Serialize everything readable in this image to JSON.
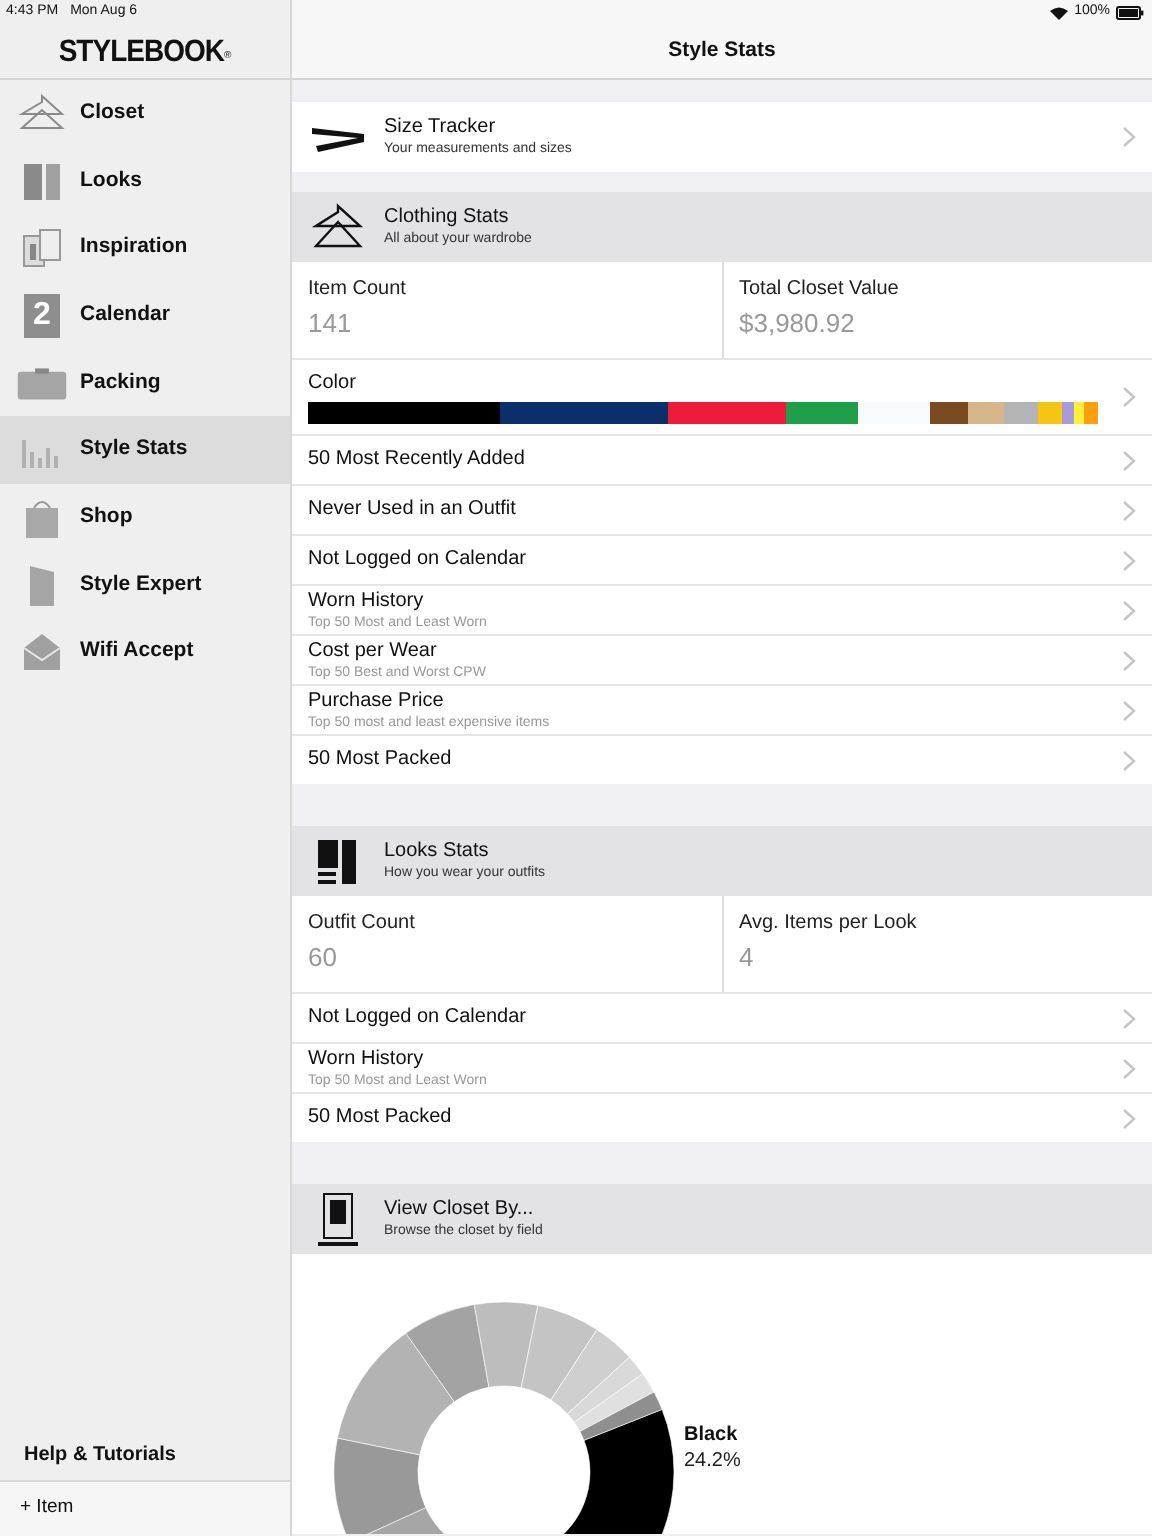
{
  "status_bar": {
    "time": "4:43 PM",
    "date": "Mon Aug 6",
    "battery": "100%"
  },
  "sidebar": {
    "logo": "STYLEBOOK",
    "logo_mark": "®",
    "items": [
      {
        "label": "Closet",
        "selected": false
      },
      {
        "label": "Looks",
        "selected": false
      },
      {
        "label": "Inspiration",
        "selected": false
      },
      {
        "label": "Calendar",
        "selected": false,
        "icon_text": "2"
      },
      {
        "label": "Packing",
        "selected": false
      },
      {
        "label": "Style Stats",
        "selected": true
      },
      {
        "label": "Shop",
        "selected": false
      },
      {
        "label": "Style Expert",
        "selected": false
      },
      {
        "label": "Wifi Accept",
        "selected": false
      }
    ],
    "help": "Help & Tutorials",
    "add_item": "+ Item"
  },
  "header": {
    "title": "Style Stats"
  },
  "sections": [
    {
      "kind": "link",
      "title": "Size Tracker",
      "subtitle": "Your measurements and sizes"
    },
    {
      "kind": "group",
      "title": "Clothing Stats",
      "subtitle": "All about your wardrobe",
      "stats": [
        {
          "label": "Item Count",
          "value": "141"
        },
        {
          "label": "Total Closet Value",
          "value": "$3,980.92"
        }
      ],
      "rows": [
        {
          "kind": "color",
          "title": "Color",
          "segments": [
            {
              "color": "#000000"
            },
            {
              "color": "#0b2f6b"
            },
            {
              "color": "#ee1b3a"
            },
            {
              "color": "#1f9e4a"
            },
            {
              "color": "#f7f9fa"
            },
            {
              "color": "#7a4a21"
            },
            {
              "color": "#d6b68a"
            },
            {
              "color": "#b4b4b4"
            },
            {
              "color": "#f4c512"
            },
            {
              "color": "#a99bd6"
            },
            {
              "color": "#fff13a"
            },
            {
              "color": "#ff9f0a"
            }
          ]
        },
        {
          "kind": "row",
          "title": "50 Most Recently Added"
        },
        {
          "kind": "row",
          "title": "Never Used in an Outfit"
        },
        {
          "kind": "row",
          "title": "Not Logged on Calendar"
        },
        {
          "kind": "row",
          "title": "Worn History",
          "subtitle": "Top 50 Most and Least Worn"
        },
        {
          "kind": "row",
          "title": "Cost per Wear",
          "subtitle": "Top 50 Best and Worst CPW"
        },
        {
          "kind": "row",
          "title": "Purchase Price",
          "subtitle": "Top 50 most and least expensive items"
        },
        {
          "kind": "row",
          "title": "50 Most Packed"
        }
      ]
    },
    {
      "kind": "group",
      "title": "Looks Stats",
      "subtitle": "How you wear your outfits",
      "stats": [
        {
          "label": "Outfit Count",
          "value": "60"
        },
        {
          "label": "Avg. Items per Look",
          "value": "4"
        }
      ],
      "rows": [
        {
          "kind": "row",
          "title": "Not Logged on Calendar"
        },
        {
          "kind": "row",
          "title": "Worn History",
          "subtitle": "Top 50 Most and Least Worn"
        },
        {
          "kind": "row",
          "title": "50 Most Packed"
        }
      ]
    },
    {
      "kind": "donut",
      "title": "View Closet By...",
      "subtitle": "Browse the closet by field",
      "callout_label": "Black",
      "callout_value": "24.2%"
    }
  ]
}
